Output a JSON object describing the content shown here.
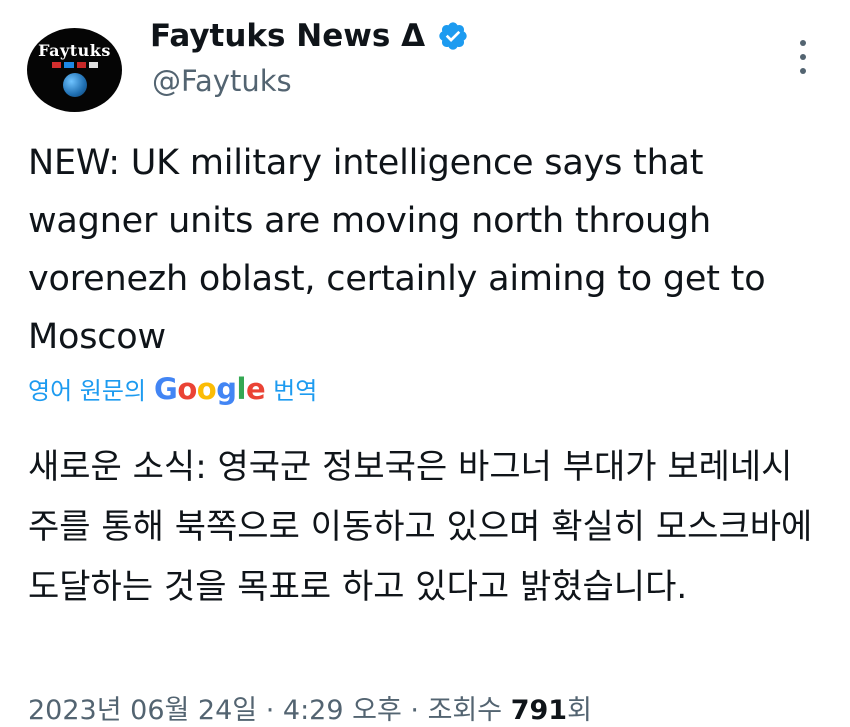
{
  "account": {
    "name": "Faytuks News Δ",
    "handle": "@Faytuks",
    "avatar_text": "Faytuks",
    "verified_icon": "verified-badge-icon",
    "verified_color": "#1d9bf0"
  },
  "tweet": {
    "text": "NEW: UK military intelligence says that wagner units are moving north through vorenezh oblast, certainly aiming to get to Moscow",
    "translate_prefix": "영어 원문의",
    "translate_brand": "Google",
    "translate_suffix": "번역",
    "translated_text": "새로운 소식: 영국군 정보국은 바그너 부대가 보레네시주를 통해 북쪽으로 이동하고 있으며 확실히 모스크바에 도달하는 것을 목표로 하고 있다고 밝혔습니다."
  },
  "meta": {
    "date": "2023년 06월 24일",
    "separator": "·",
    "time": "4:29 오후",
    "views_label": "조회수",
    "views_count": "791",
    "views_suffix": "회"
  },
  "colors": {
    "link": "#1d9bf0",
    "secondary_text": "#536471",
    "primary_text": "#0f1419"
  },
  "icons": {
    "more": "more-options-icon"
  }
}
